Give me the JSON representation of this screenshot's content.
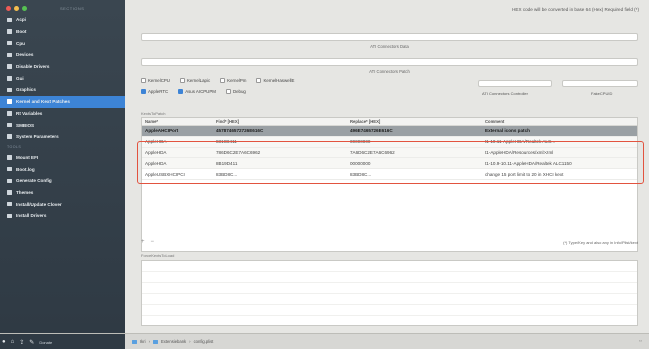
{
  "sidebar": {
    "caption": "SECTIONS",
    "traffic_colors": [
      "#ee5b56",
      "#f4be4f",
      "#56c152"
    ],
    "items": [
      {
        "label": "Acpi",
        "name": "sidebar-item-acpi"
      },
      {
        "label": "Boot",
        "name": "sidebar-item-boot"
      },
      {
        "label": "Cpu",
        "name": "sidebar-item-cpu"
      },
      {
        "label": "Devices",
        "name": "sidebar-item-devices"
      },
      {
        "label": "Disable Drivers",
        "name": "sidebar-item-disable-drivers"
      },
      {
        "label": "Gui",
        "name": "sidebar-item-gui"
      },
      {
        "label": "Graphics",
        "name": "sidebar-item-graphics"
      },
      {
        "label": "Kernel and Kext Patches",
        "name": "sidebar-item-kernel-and-kext-patches"
      },
      {
        "label": "Rt Variables",
        "name": "sidebar-item-rt-variables"
      },
      {
        "label": "SMBIOS",
        "name": "sidebar-item-smbios"
      },
      {
        "label": "System Parameters",
        "name": "sidebar-item-system-parameters"
      }
    ],
    "tools_caption": "TOOLS",
    "tools": [
      {
        "label": "Mount EFI",
        "name": "sidebar-tool-mount-efi"
      },
      {
        "label": "Boot.log",
        "name": "sidebar-tool-boot-log"
      },
      {
        "label": "Generate Config",
        "name": "sidebar-tool-generate-config"
      },
      {
        "label": "Themes",
        "name": "sidebar-tool-themes"
      },
      {
        "label": "Install/Update Clover",
        "name": "sidebar-tool-install-update-clover"
      },
      {
        "label": "Install Drivers",
        "name": "sidebar-tool-install-drivers"
      }
    ],
    "bottom_label": "Donate"
  },
  "header": {
    "hint": "HEX code will be converted in base 64 (Hex)   Required field (*)"
  },
  "fields": {
    "ati_connectors_data": "ATI Connectors Data",
    "ati_connectors_patch": "ATI Connectors Patch"
  },
  "checkboxes": {
    "row1": [
      {
        "label": "KernelCPU",
        "checked": false
      },
      {
        "label": "KernelLapic",
        "checked": false
      },
      {
        "label": "KernelPm",
        "checked": false
      },
      {
        "label": "KernelHaswellE",
        "checked": false
      }
    ],
    "row2": [
      {
        "label": "AppleRTC",
        "checked": true
      },
      {
        "label": "Asus AICPUPM",
        "checked": true
      },
      {
        "label": "Debug",
        "checked": false
      }
    ],
    "ati_controller_caption": "ATI Connectors Controller",
    "fake_cpuid_caption": "FakeCPUID"
  },
  "kexts_table": {
    "title": "KextsToPatch",
    "columns": [
      "Name*",
      "Find* [HEX]",
      "Replace* [HEX]",
      "Comment"
    ],
    "rows": [
      {
        "name": "AppleAHCIPort",
        "find": "4578746572726E616C",
        "replace": "496E7465726E616C",
        "comment": "External icons patch",
        "state": "sel"
      },
      {
        "name": "AppleHDA",
        "find": "8319D411",
        "replace": "00000000",
        "comment": "t1-10.11-AppleHDA/Realtek ALC...",
        "state": "hl"
      },
      {
        "name": "AppleHDA",
        "find": "786D6C2E7A6C6962",
        "replace": "7A6D6C2E7A6C6962",
        "comment": "t1-AppleHDA/Resources/xml>zml",
        "state": "hl"
      },
      {
        "name": "AppleHDA",
        "find": "8B19D411",
        "replace": "00000000",
        "comment": "t1-10.9-10.11-AppleHDA/Realtek ALC1150",
        "state": "hl"
      },
      {
        "name": "AppleUSBXHCIPCI",
        "find": "83BD8C...",
        "replace": "83BD8C...",
        "comment": "change 15 port limit to 20 in XHCI kext",
        "state": ""
      }
    ],
    "footer_note": "(*) Type/Key and also any in Info/Plist/kext",
    "footer_buttons": [
      "+",
      "−"
    ]
  },
  "force_kexts": {
    "title": "ForceKextsToLoad"
  },
  "bottom_bar": {
    "breadcrumb": [
      "Ikri",
      "Extensiebank",
      "config.plist"
    ],
    "right": "⇔"
  }
}
